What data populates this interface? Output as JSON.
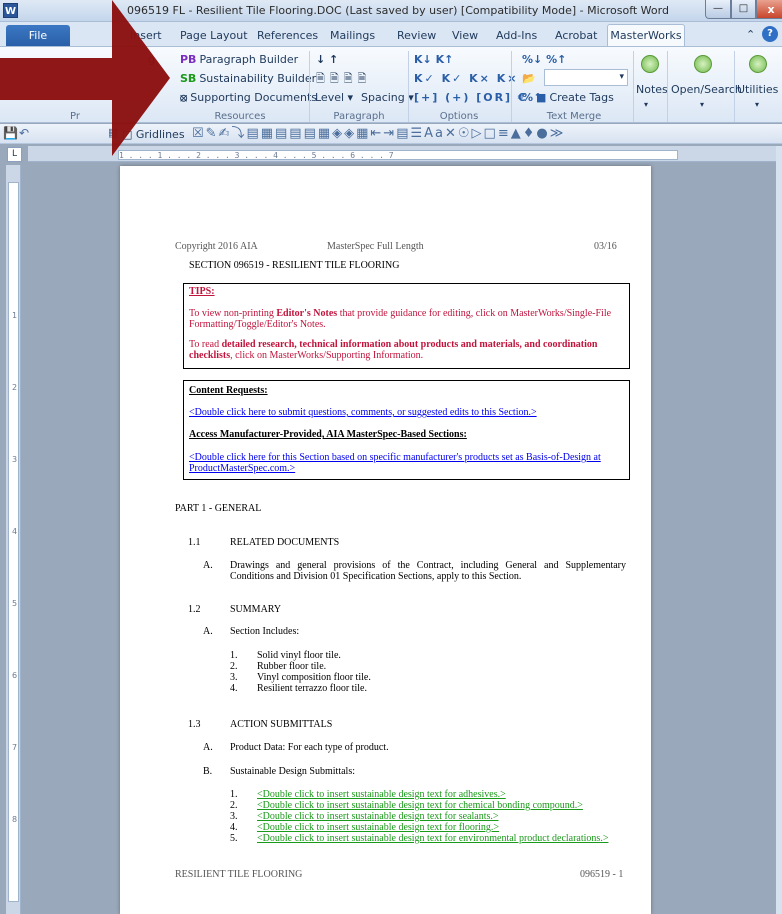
{
  "window": {
    "title": "096519 FL - Resilient Tile Flooring.DOC (Last saved by user) [Compatibility Mode]  -  Microsoft Word",
    "app_icon": "W",
    "close_glyph": "x"
  },
  "tabs": {
    "file": "File",
    "items": [
      "Insert",
      "Page Layout",
      "References",
      "Mailings",
      "Review",
      "View",
      "Add-Ins",
      "Acrobat"
    ],
    "active": "MasterWorks"
  },
  "ribbon": {
    "resources": {
      "paragraph_builder": "Paragraph Builder",
      "sustainability_builder": "Sustainability Builder",
      "supporting_documents": "Supporting Documents",
      "label": "Resources",
      "partial_label": "Pr",
      "partial_button": "g"
    },
    "paragraph": {
      "level": "Level",
      "spacing": "Spacing",
      "label": "Paragraph"
    },
    "options": {
      "label": "Options"
    },
    "text_merge": {
      "create_tags": "Create Tags",
      "label": "Text Merge"
    },
    "right_buttons": {
      "notes": "Notes",
      "open_search": "Open/Search",
      "utilities": "Utilities"
    }
  },
  "qat": {
    "gridlines": "Gridlines"
  },
  "ruler": {
    "marks": "1 . . . 1 . . . 2 . . . 3 . . . 4 . . . 5 . . . 6 . . . 7"
  },
  "document": {
    "header": {
      "left": "Copyright 2016 AIA",
      "center": "MasterSpec Full Length",
      "right": "03/16"
    },
    "section_title": "SECTION 096519 - RESILIENT TILE FLOORING",
    "tips": {
      "heading": "TIPS:",
      "p1_pre": "To view non-printing ",
      "p1_bold": "Editor's Notes",
      "p1_post": " that provide guidance for editing, click on MasterWorks/Single-File",
      "p1_line2": "Formatting/Toggle/Editor's Notes.",
      "p2_pre": "To read ",
      "p2_bold": "detailed research, technical information about products and materials, and coordination",
      "p2_bold2": "checklists",
      "p2_post": ", click on MasterWorks/Supporting Information."
    },
    "content_box": {
      "heading": "Content Requests:",
      "link1": "<Double click here to submit questions, comments, or suggested edits to this Section.>",
      "heading2": "Access Manufacturer-Provided, AIA MasterSpec-Based Sections:",
      "link2_line1": "<Double click here for this Section based on specific manufacturer's products set as Basis-of-Design at",
      "link2_line2": "ProductMasterSpec.com.>"
    },
    "part1": "PART 1 - GENERAL",
    "s11": {
      "num": "1.1",
      "title": "RELATED DOCUMENTS",
      "a": "A.",
      "a_line1": "Drawings and general provisions of the Contract, including General and Supplementary",
      "a_line2": "Conditions and Division 01 Specification Sections, apply to this Section."
    },
    "s12": {
      "num": "1.2",
      "title": "SUMMARY",
      "a": "A.",
      "a_text": "Section Includes:",
      "items": [
        {
          "n": "1.",
          "t": "Solid vinyl floor tile."
        },
        {
          "n": "2.",
          "t": "Rubber floor tile."
        },
        {
          "n": "3.",
          "t": "Vinyl composition floor tile."
        },
        {
          "n": "4.",
          "t": "Resilient terrazzo floor tile."
        }
      ]
    },
    "s13": {
      "num": "1.3",
      "title": "ACTION SUBMITTALS",
      "a": "A.",
      "a_text": "Product Data: For each type of product.",
      "b": "B.",
      "b_text": "Sustainable Design Submittals:",
      "items": [
        {
          "n": "1.",
          "t": "<Double click to insert sustainable design text for adhesives.>"
        },
        {
          "n": "2.",
          "t": "<Double click to insert sustainable design text for chemical bonding compound.>"
        },
        {
          "n": "3.",
          "t": "<Double click to insert sustainable design text for sealants.>"
        },
        {
          "n": "4.",
          "t": "<Double click to insert sustainable design text for flooring.>"
        },
        {
          "n": "5.",
          "t": "<Double click to insert sustainable design text for environmental product declarations.>"
        }
      ]
    },
    "footer": {
      "left": "RESILIENT TILE FLOORING",
      "right": "096519 - 1"
    }
  },
  "colors": {
    "arrow": "#8b1010",
    "tips_red": "#c0143c",
    "link_blue": "#0000ee",
    "link_green": "#1a9a1a",
    "file_tab": "#2a5fa8"
  }
}
